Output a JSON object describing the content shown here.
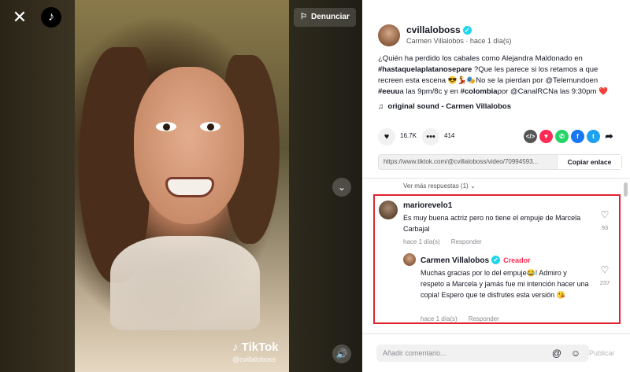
{
  "video": {
    "report_label": "Denunciar",
    "watermark_title": "TikTok",
    "watermark_user": "@cvillaloboss"
  },
  "post": {
    "username": "cvillaloboss",
    "display_name": "Carmen Villalobos",
    "separator": " · ",
    "time": "hace 1 día(s)",
    "description_parts": {
      "p1": "¿Quién ha perdido los cabales como Alejandra Maldonado en ",
      "tag1": "#hastaquelaplatanosepare",
      "p2": " ?Que les parece si los retamos a que recreen esta escena 😎💃🎭No se la pierdan por ",
      "mention1": "@Telemundo",
      "p3": "en ",
      "tag2": "#eeuu",
      "p4": "a las 9pm/8c y en ",
      "tag3": "#colombia",
      "p5": "por ",
      "mention2": "@CanalRCN",
      "p6": "a las 9:30pm ❤️"
    },
    "sound": "original sound - Carmen Villalobos",
    "likes": "16.7K",
    "comments_count": "414",
    "share_link": "https://www.tiktok.com/@cvillaloboss/video/70994593...",
    "copy_label": "Copiar enlace"
  },
  "comments": {
    "more_replies": "Ver más respuestas (1)",
    "items": [
      {
        "author": "mariorevelo1",
        "text": "Es muy buena actriz pero no tiene el empuje de Marcela Carbajal",
        "time": "hace 1 día(s)",
        "reply_label": "Responder",
        "likes": "93"
      },
      {
        "author": "Carmen Villalobos",
        "badge": "Creador",
        "text": "Muchas gracias por lo del empuje😂! Admiro y respeto a Marcela y jamás fue mi intención hacer una copia! Espero que te disfrutes esta versión 😘",
        "time": "hace 1 día(s)",
        "reply_label": "Responder",
        "likes": "237"
      }
    ]
  },
  "composer": {
    "placeholder": "Añadir comentario...",
    "post_label": "Publicar"
  },
  "colors": {
    "accent": "#fe2c55",
    "highlight_border": "#e0232f",
    "verified": "#20d5ec"
  }
}
